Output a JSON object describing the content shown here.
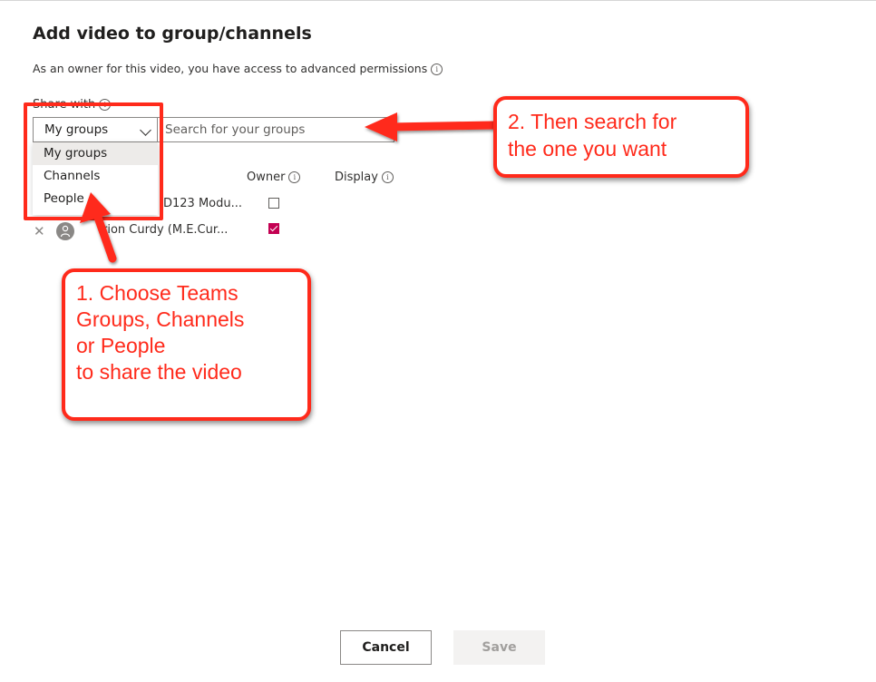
{
  "dialog": {
    "title": "Add video to group/channels",
    "subtitle": "As an owner for this video, you have access to advanced permissions",
    "share_with_label": "Share with"
  },
  "share_type": {
    "selected": "My groups",
    "options": [
      "My groups",
      "Channels",
      "People"
    ]
  },
  "search": {
    "placeholder": "Search for your groups"
  },
  "columns": {
    "owner": "Owner",
    "display": "Display"
  },
  "rows": [
    {
      "name": "D123 Modu...",
      "owner_checked": false
    },
    {
      "name": "rion Curdy (M.E.Cur...",
      "owner_checked": true
    }
  ],
  "annotations": {
    "callout_1": [
      "1. Choose Teams",
      "Groups, Channels",
      "or People",
      "to share the video"
    ],
    "callout_2": [
      "2. Then search for",
      "the one you want"
    ],
    "color": "#ff2a1b"
  },
  "footer": {
    "cancel": "Cancel",
    "save": "Save"
  },
  "colors": {
    "accent_check": "#c30052",
    "annotation": "#ff2a1b"
  }
}
